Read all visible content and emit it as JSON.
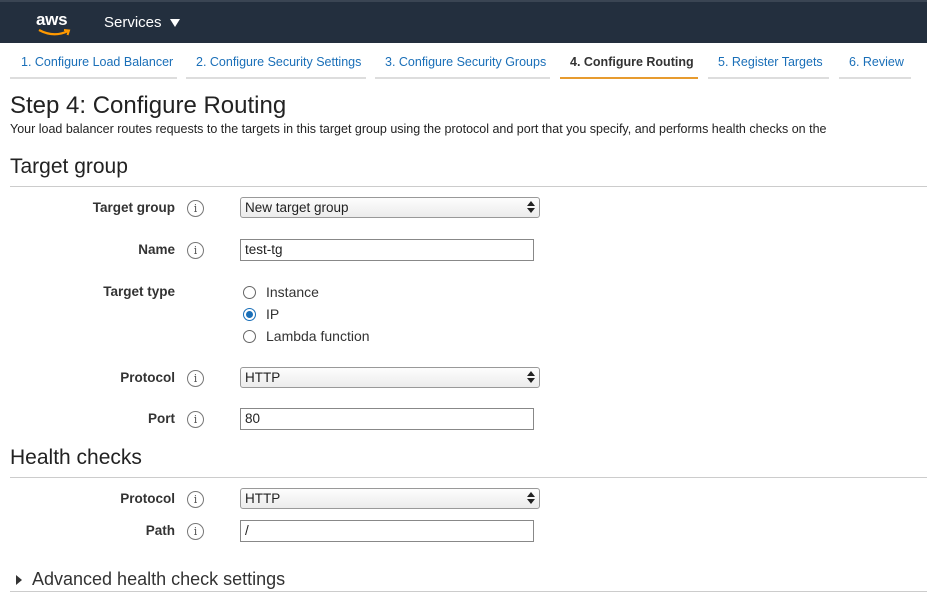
{
  "topnav": {
    "logo_text": "aws",
    "services_label": "Services"
  },
  "steps": [
    {
      "label": "1. Configure Load Balancer",
      "active": false
    },
    {
      "label": "2. Configure Security Settings",
      "active": false
    },
    {
      "label": "3. Configure Security Groups",
      "active": false
    },
    {
      "label": "4. Configure Routing",
      "active": true
    },
    {
      "label": "5. Register Targets",
      "active": false
    },
    {
      "label": "6. Review",
      "active": false
    }
  ],
  "page": {
    "title": "Step 4: Configure Routing",
    "description": "Your load balancer routes requests to the targets in this target group using the protocol and port that you specify, and performs health checks on the"
  },
  "target_group_section": {
    "title": "Target group",
    "target_group_label": "Target group",
    "target_group_value": "New target group",
    "name_label": "Name",
    "name_value": "test-tg",
    "target_type_label": "Target type",
    "target_type_options": [
      "Instance",
      "IP",
      "Lambda function"
    ],
    "target_type_selected": "IP",
    "protocol_label": "Protocol",
    "protocol_value": "HTTP",
    "port_label": "Port",
    "port_value": "80"
  },
  "health_checks_section": {
    "title": "Health checks",
    "protocol_label": "Protocol",
    "protocol_value": "HTTP",
    "path_label": "Path",
    "path_value": "/",
    "advanced_label": "Advanced health check settings"
  },
  "info_icon_glyph": "i",
  "colors": {
    "nav_bg": "#232f3e",
    "link": "#1a6fb8",
    "active_step_underline": "#e79b2f"
  }
}
